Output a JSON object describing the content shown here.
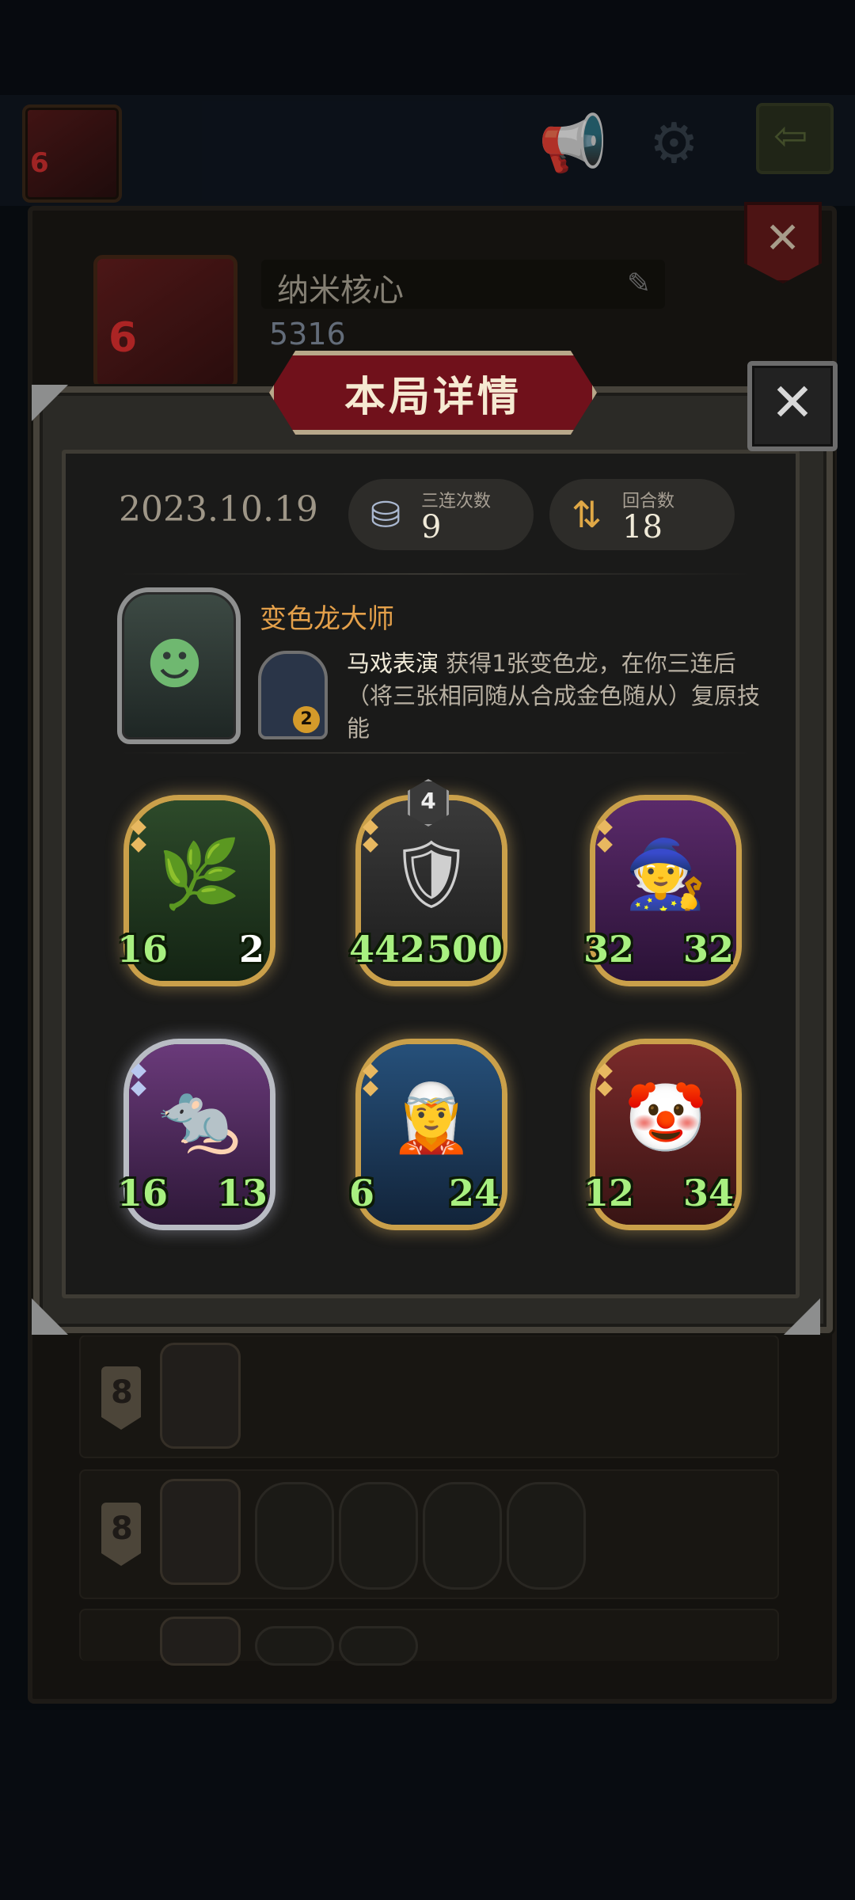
{
  "hud": {
    "player_level": "6"
  },
  "profile": {
    "name": "纳米核心",
    "level": "6",
    "score": "5316",
    "history_rows": [
      {
        "rank": "8"
      },
      {
        "rank": "8"
      }
    ]
  },
  "modal": {
    "title": "本局详情",
    "date": "2023.10.19",
    "triples_label": "三连次数",
    "triples_value": "9",
    "rounds_label": "回合数",
    "rounds_value": "18",
    "hero_name": "变色龙大师",
    "hero_skill_cost": "2",
    "skill_name": "马戏表演",
    "skill_desc": "获得1张变色龙，在你三连后（将三张相同随从合成金色随从）复原技能"
  },
  "units": [
    {
      "attack": "16",
      "health": "2",
      "tier": "",
      "frame": "gold",
      "art": "plant"
    },
    {
      "attack": "442",
      "health": "500",
      "tier": "4",
      "frame": "gold",
      "art": "knight"
    },
    {
      "attack": "32",
      "health": "32",
      "tier": "",
      "frame": "gold",
      "art": "wizard"
    },
    {
      "attack": "16",
      "health": "13",
      "tier": "",
      "frame": "silver",
      "art": "rat"
    },
    {
      "attack": "6",
      "health": "24",
      "tier": "",
      "frame": "gold",
      "art": "elf"
    },
    {
      "attack": "12",
      "health": "34",
      "tier": "",
      "frame": "gold",
      "art": "clown"
    }
  ],
  "colors": {
    "banner": "#70111b",
    "attack_text": "#a8f080",
    "hero_name": "#e4a04a",
    "gold_frame": "#caa04a"
  }
}
